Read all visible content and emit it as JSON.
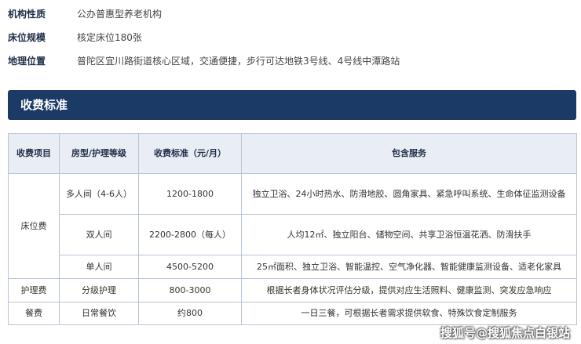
{
  "info": [
    {
      "label": "机构性质",
      "value": "公办普惠型养老机构"
    },
    {
      "label": "床位规模",
      "value": "核定床位180张"
    },
    {
      "label": "地理位置",
      "value": "普陀区宜川路街道核心区域，交通便捷，步行可达地铁3号线、4号线中潭路站"
    }
  ],
  "section_title": "收费标准",
  "table": {
    "headers": [
      "收费项目",
      "房型/护理等级",
      "收费标准（元/月）",
      "包含服务"
    ],
    "rows": [
      {
        "item": "床位费",
        "type": "多人间（4-6人）",
        "price": "1200-1800",
        "services": "独立卫浴、24小时热水、防滑地胶、圆角家具、紧急呼叫系统、生命体征监测设备"
      },
      {
        "type": "双人间",
        "price": "2200-2800（每人）",
        "services": "人均12㎡、独立阳台、储物空间、共享卫浴恒温花洒、防滑扶手"
      },
      {
        "type": "单人间",
        "price": "4500-5200",
        "services": "25㎡面积、独立卫浴、智能温控、空气净化器、智能健康监测设备、适老化家具"
      },
      {
        "item": "护理费",
        "type": "分级护理",
        "price": "800-3000",
        "services": "根据长者身体状况评估分级，提供对应生活照料、健康监测、突发应急响应"
      },
      {
        "item": "餐费",
        "type": "日常餐饮",
        "price": "约800",
        "services": "一日三餐，可根据长者需求提供软食、特殊饮食定制服务"
      }
    ]
  },
  "watermark": "搜狐号@搜狐焦点白银站"
}
